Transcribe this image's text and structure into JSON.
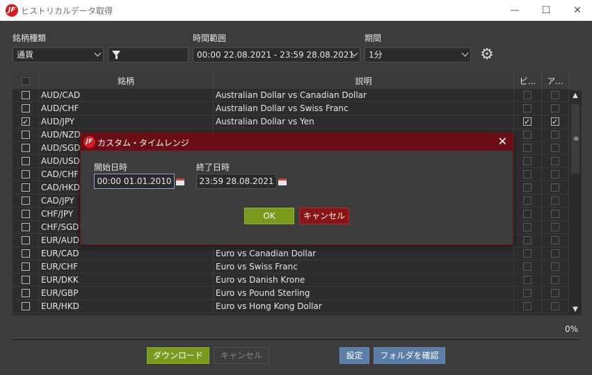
{
  "window": {
    "title": "ヒストリカルデータ取得",
    "logo": "JF",
    "minimize": "—",
    "maximize": "☐",
    "close": "✕"
  },
  "filters": {
    "type_label": "銘柄種類",
    "type_value": "通貨",
    "range_label": "時間範囲",
    "range_value": "00:00 22.08.2021 - 23:59 28.08.2021",
    "period_label": "期間",
    "period_value": "1分",
    "filter_icon": "filter-icon",
    "settings_icon": "gear-icon"
  },
  "table": {
    "headers": {
      "symbol": "銘柄",
      "description": "説明",
      "col_bid": "ビ...",
      "col_ask": "ア..."
    },
    "rows": [
      {
        "symbol": "AUD/CAD",
        "description": "Australian Dollar vs Canadian Dollar",
        "checked": false,
        "bid": false,
        "ask": false
      },
      {
        "symbol": "AUD/CHF",
        "description": "Australian Dollar vs Swiss Franc",
        "checked": false,
        "bid": false,
        "ask": false
      },
      {
        "symbol": "AUD/JPY",
        "description": "Australian Dollar vs Yen",
        "checked": true,
        "bid": true,
        "ask": true
      },
      {
        "symbol": "AUD/NZD",
        "description": "",
        "checked": false,
        "bid": false,
        "ask": false
      },
      {
        "symbol": "AUD/SGD",
        "description": "",
        "checked": false,
        "bid": false,
        "ask": false
      },
      {
        "symbol": "AUD/USD",
        "description": "",
        "checked": false,
        "bid": false,
        "ask": false
      },
      {
        "symbol": "CAD/CHF",
        "description": "",
        "checked": false,
        "bid": false,
        "ask": false
      },
      {
        "symbol": "CAD/HKD",
        "description": "",
        "checked": false,
        "bid": false,
        "ask": false
      },
      {
        "symbol": "CAD/JPY",
        "description": "",
        "checked": false,
        "bid": false,
        "ask": false
      },
      {
        "symbol": "CHF/JPY",
        "description": "",
        "checked": false,
        "bid": false,
        "ask": false
      },
      {
        "symbol": "CHF/SGD",
        "description": "",
        "checked": false,
        "bid": false,
        "ask": false
      },
      {
        "symbol": "EUR/AUD",
        "description": "",
        "checked": false,
        "bid": false,
        "ask": false
      },
      {
        "symbol": "EUR/CAD",
        "description": "Euro vs Canadian Dollar",
        "checked": false,
        "bid": false,
        "ask": false
      },
      {
        "symbol": "EUR/CHF",
        "description": "Euro vs Swiss Franc",
        "checked": false,
        "bid": false,
        "ask": false
      },
      {
        "symbol": "EUR/DKK",
        "description": "Euro vs Danish Krone",
        "checked": false,
        "bid": false,
        "ask": false
      },
      {
        "symbol": "EUR/GBP",
        "description": "Euro vs Pound Sterling",
        "checked": false,
        "bid": false,
        "ask": false
      },
      {
        "symbol": "EUR/HKD",
        "description": "Euro vs Hong Kong Dollar",
        "checked": false,
        "bid": false,
        "ask": false
      }
    ]
  },
  "progress": {
    "percent_label": "0%",
    "value": 0
  },
  "footer": {
    "download": "ダウンロード",
    "cancel": "キャンセル",
    "settings": "設定",
    "open_folder": "フォルダを確認"
  },
  "modal": {
    "title": "カスタム・タイムレンジ",
    "start_label": "開始日時",
    "start_value": "00:00 01.01.2010",
    "end_label": "終了日時",
    "end_value": "23:59 28.08.2021",
    "ok": "OK",
    "cancel": "キャンセル",
    "close": "✕"
  },
  "colors": {
    "accent_green": "#7a9a1c",
    "accent_blue": "#5a7ea8",
    "modal_title": "#6b0f14",
    "brand_red": "#d71920"
  }
}
